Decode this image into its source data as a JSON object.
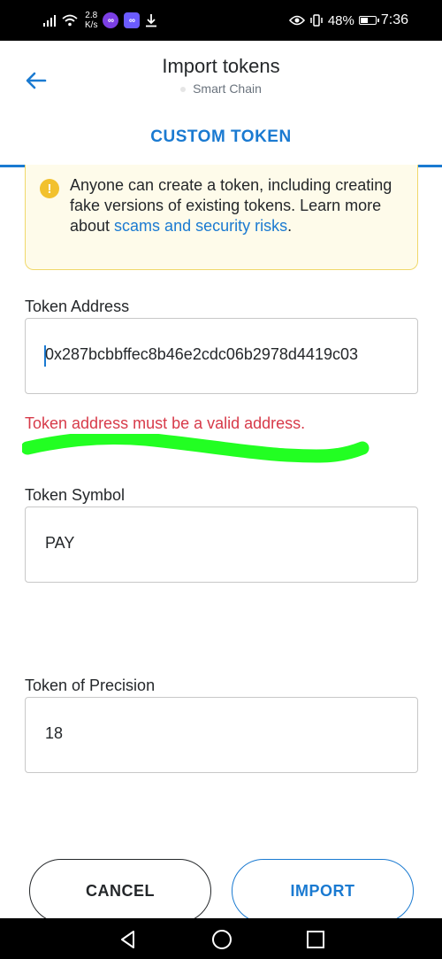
{
  "status_bar": {
    "net_speed_value": "2.8",
    "net_speed_unit": "K/s",
    "battery_percent": "48%",
    "battery_level": 0.48,
    "time": "7:36",
    "icons": [
      "signal-icon",
      "wifi-icon",
      "app-notification-icon",
      "app-notification-icon",
      "download-icon",
      "eye-icon",
      "vibrate-icon",
      "battery-icon"
    ]
  },
  "header": {
    "title": "Import tokens",
    "network": "Smart Chain",
    "back_icon": "back-arrow-icon"
  },
  "tabs": {
    "active": "CUSTOM TOKEN"
  },
  "warning": {
    "text": "Anyone can create a token, including creating fake versions of existing tokens. Learn more about ",
    "link": "scams and security risks",
    "end": "."
  },
  "form": {
    "address_label": "Token Address",
    "address_value": "0x287bcbbffec8b46e2cdc06b2978d4419c03",
    "error": "Token address must be a valid address.",
    "symbol_label": "Token Symbol",
    "symbol_value": "PAY",
    "precision_label": "Token of Precision",
    "precision_value": "18"
  },
  "buttons": {
    "cancel": "CANCEL",
    "import": "IMPORT"
  },
  "colors": {
    "accent": "#1a7ad1",
    "error": "#d73a49",
    "warning_bg": "#fefbea",
    "warning_border": "#f0d86a",
    "highlight": "#22ff22"
  },
  "nav": {
    "icons": [
      "nav-back-icon",
      "nav-home-icon",
      "nav-recents-icon"
    ]
  }
}
